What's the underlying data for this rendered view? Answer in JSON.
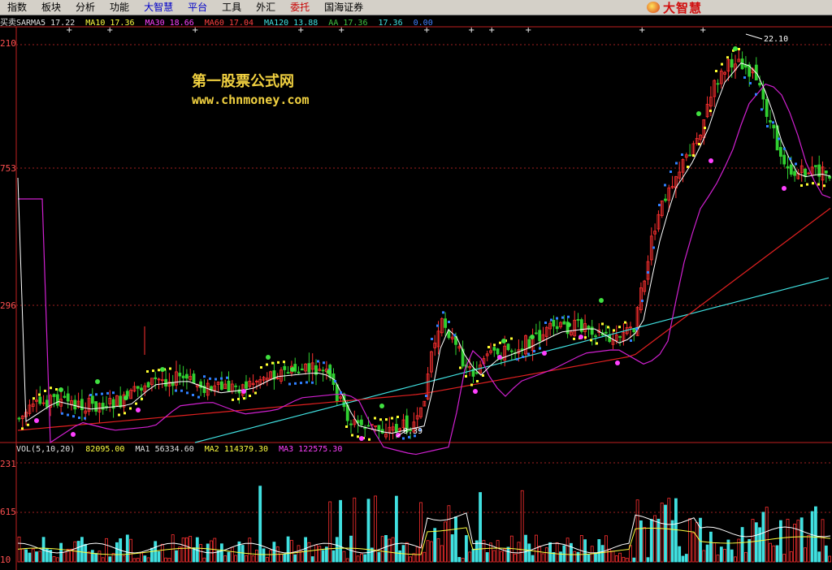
{
  "menu": {
    "items": [
      {
        "label": "指数",
        "style": "normal"
      },
      {
        "label": "板块",
        "style": "normal"
      },
      {
        "label": "分析",
        "style": "normal"
      },
      {
        "label": "功能",
        "style": "normal"
      },
      {
        "label": "大智慧",
        "style": "blue"
      },
      {
        "label": "平台",
        "style": "blue"
      },
      {
        "label": "工具",
        "style": "normal"
      },
      {
        "label": "外汇",
        "style": "normal"
      },
      {
        "label": "委托",
        "style": "red"
      },
      {
        "label": "国海证券",
        "style": "normal"
      }
    ],
    "logo_text": "大智慧"
  },
  "legend": {
    "items": [
      {
        "text": "买卖SARMA5  17.22",
        "color": "#e0e0e0"
      },
      {
        "text": "MA10  17.36",
        "color": "#ffff40"
      },
      {
        "text": "MA30  18.66",
        "color": "#ff40ff"
      },
      {
        "text": "MA60  17.04",
        "color": "#ff4040"
      },
      {
        "text": "MA120  13.88",
        "color": "#40e0e0"
      },
      {
        "text": "AA  17.36",
        "color": "#40c040"
      },
      {
        "text": "17.36",
        "color": "#40e0e0"
      },
      {
        "text": "0.00",
        "color": "#4080ff"
      }
    ]
  },
  "price_axis": {
    "labels": [
      "210",
      "753",
      "296"
    ],
    "high_label": "22.10",
    "low_label": "8.39"
  },
  "volume_legend": {
    "items": [
      {
        "text": "VOL(5,10,20)",
        "color": "#e0e0e0"
      },
      {
        "text": "82095.00",
        "color": "#ffff40"
      },
      {
        "text": "MA1  56334.60",
        "color": "#e0e0e0"
      },
      {
        "text": "MA2  114379.30",
        "color": "#ffff40"
      },
      {
        "text": "MA3  122575.30",
        "color": "#ff40ff"
      }
    ]
  },
  "volume_axis": {
    "labels": [
      "231",
      "615",
      "10"
    ]
  },
  "watermark": {
    "title": "第一股票公式网",
    "url": "www.chnmoney.com"
  },
  "signals": {
    "buy": "买",
    "sell": "卖"
  },
  "colors": {
    "up": "#ff3030",
    "down": "#30d030",
    "cyan_line": "#40e0e0",
    "red_line": "#e02020",
    "magenta_line": "#d020d0",
    "white_line": "#ffffff"
  }
}
